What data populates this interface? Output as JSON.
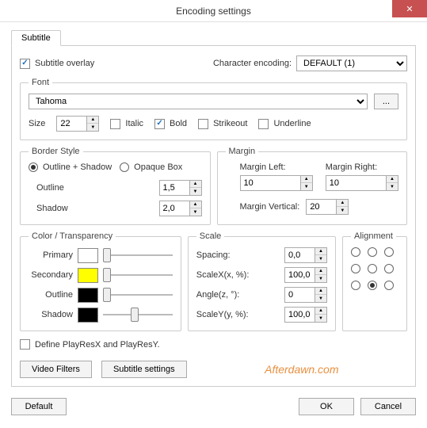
{
  "window": {
    "title": "Encoding settings"
  },
  "tab": {
    "subtitle": "Subtitle"
  },
  "subtitle_overlay": {
    "label": "Subtitle overlay",
    "checked": true
  },
  "char_encoding": {
    "label": "Character encoding:",
    "value": "DEFAULT (1)"
  },
  "font_group": {
    "legend": "Font",
    "family": "Tahoma",
    "ellipsis": "...",
    "size_label": "Size",
    "size": "22",
    "italic": "Italic",
    "bold": "Bold",
    "strikeout": "Strikeout",
    "underline": "Underline"
  },
  "border_style": {
    "legend": "Border Style",
    "outline_shadow": "Outline + Shadow",
    "opaque_box": "Opaque Box",
    "outline_label": "Outline",
    "outline": "1,5",
    "shadow_label": "Shadow",
    "shadow": "2,0"
  },
  "margin": {
    "legend": "Margin",
    "left_label": "Margin Left:",
    "left": "10",
    "right_label": "Margin Right:",
    "right": "10",
    "vert_label": "Margin Vertical:",
    "vert": "20"
  },
  "color": {
    "legend": "Color / Transparency",
    "primary": "Primary",
    "secondary": "Secondary",
    "outline": "Outline",
    "shadow": "Shadow",
    "colors": {
      "primary": "#ffffff",
      "secondary": "#ffff00",
      "outline": "#000000",
      "shadow": "#000000"
    }
  },
  "scale": {
    "legend": "Scale",
    "spacing_label": "Spacing:",
    "spacing": "0,0",
    "scalex_label": "ScaleX(x, %):",
    "scalex": "100,0",
    "angle_label": "Angle(z, °):",
    "angle": "0",
    "scaley_label": "ScaleY(y, %):",
    "scaley": "100,0"
  },
  "alignment": {
    "legend": "Alignment",
    "selected": 7
  },
  "playres": {
    "label": "Define PlayResX and PlayResY."
  },
  "buttons": {
    "video_filters": "Video Filters",
    "subtitle_settings": "Subtitle settings",
    "default": "Default",
    "ok": "OK",
    "cancel": "Cancel"
  },
  "watermark": "Afterdawn.com"
}
